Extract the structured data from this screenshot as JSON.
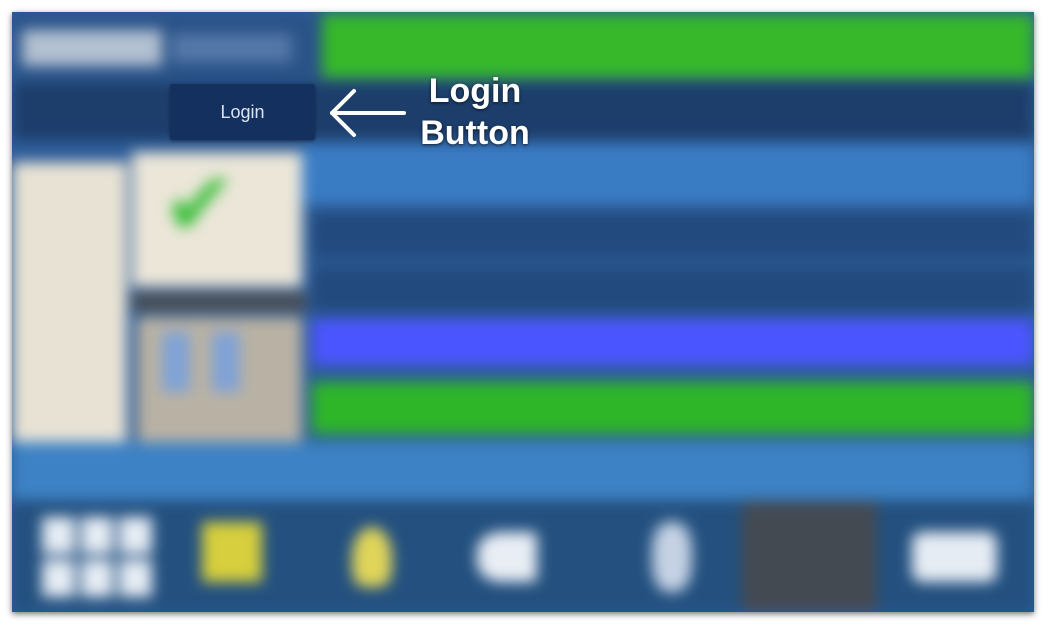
{
  "login_button": {
    "label": "Login"
  },
  "annotation": {
    "line1": "Login",
    "line2": "Button"
  },
  "colors": {
    "status_banner": "#36b82a",
    "status_row": "#4b55ff",
    "online_row": "#2fb628",
    "nav_bar": "#1d3e6b",
    "login_button": "#14305e",
    "background": "#2d5d99"
  },
  "icons": [
    "checkmark-icon",
    "grid-menu-icon",
    "floor-plan-icon",
    "light-bulb-icon",
    "pump-icon",
    "person-icon",
    "screen-icon",
    "truck-icon",
    "arrow-left-icon"
  ]
}
